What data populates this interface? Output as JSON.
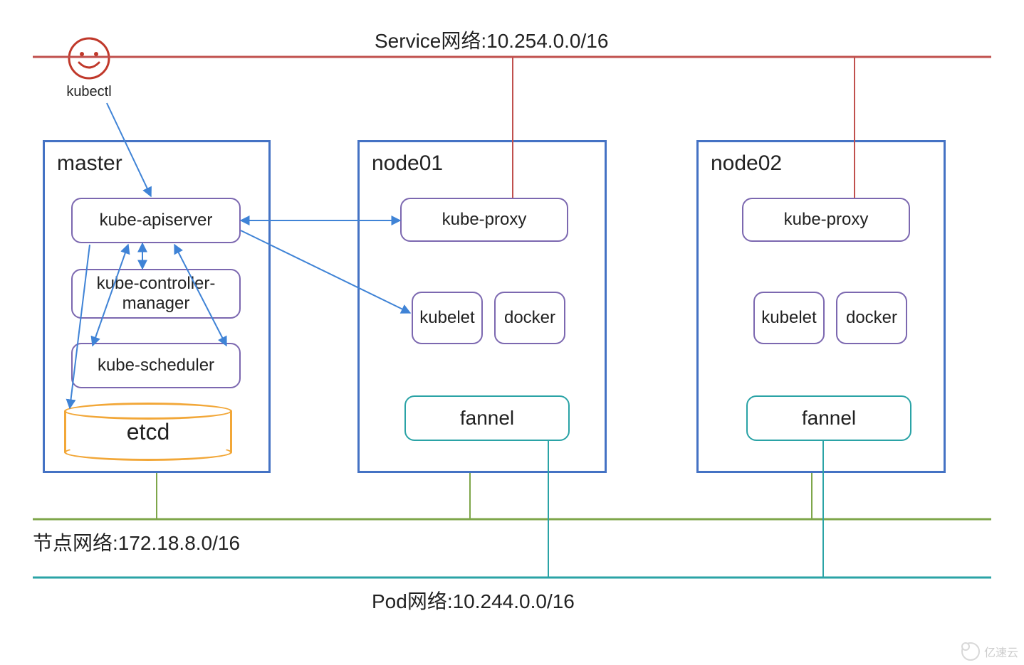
{
  "kubectl": {
    "label": "kubectl"
  },
  "nodes": {
    "master": {
      "title": "master",
      "components": {
        "apiserver": "kube-apiserver",
        "controller": "kube-controller-\nmanager",
        "scheduler": "kube-scheduler",
        "etcd": "etcd"
      }
    },
    "node01": {
      "title": "node01",
      "components": {
        "proxy": "kube-proxy",
        "kubelet": "kubelet",
        "docker": "docker",
        "fannel": "fannel"
      }
    },
    "node02": {
      "title": "node02",
      "components": {
        "proxy": "kube-proxy",
        "kubelet": "kubelet",
        "docker": "docker",
        "fannel": "fannel"
      }
    }
  },
  "networks": {
    "service": "Service网络:10.254.0.0/16",
    "node": "节点网络:172.18.8.0/16",
    "pod": "Pod网络:10.244.0.0/16"
  },
  "watermark": "亿速云"
}
